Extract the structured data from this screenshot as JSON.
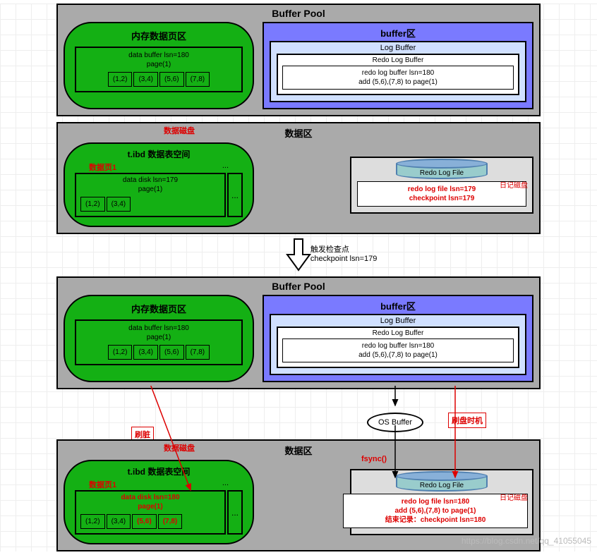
{
  "top": {
    "buffer_pool_title": "Buffer Pool",
    "mem_area_title": "内存数据页区",
    "data_buffer_text": "data buffer lsn=180\npage(1)",
    "cells": [
      "(1,2)",
      "(3,4)",
      "(5,6)",
      "(7,8)"
    ],
    "buffer_area_title": "buffer区",
    "log_buffer_title": "Log Buffer",
    "redo_log_buffer_title": "Redo Log Buffer",
    "redo_buffer_content": "redo log buffer lsn=180\nadd (5,6),(7,8) to page(1)",
    "data_area_title": "数据区",
    "data_disk_label": "数据磁盘",
    "tablespace_title": "t.ibd 数据表空间",
    "data_page_label": "数据页1",
    "data_disk_text": "data disk lsn=179\npage(1)",
    "disk_cells": [
      "(1,2)",
      "(3,4)"
    ],
    "dots": "...",
    "redo_log_file_title": "Redo Log File",
    "redo_disk_label": "日记磁盘",
    "redo_file_content": "redo log file lsn=179\ncheckpoint lsn=179"
  },
  "arrow": {
    "trigger_text": "触发检查点",
    "checkpoint_text": "checkpoint lsn=179"
  },
  "bottom": {
    "buffer_pool_title": "Buffer Pool",
    "mem_area_title": "内存数据页区",
    "data_buffer_text": "data buffer lsn=180\npage(1)",
    "cells": [
      "(1,2)",
      "(3,4)",
      "(5,6)",
      "(7,8)"
    ],
    "buffer_area_title": "buffer区",
    "log_buffer_title": "Log Buffer",
    "redo_log_buffer_title": "Redo Log Buffer",
    "redo_buffer_content": "redo log buffer lsn=180\nadd (5,6),(7,8) to page(1)",
    "os_buffer_label": "OS Buffer",
    "flush_timing_label": "刷盘时机",
    "fsync_label": "fsync()",
    "dirty_flush_label": "刷脏",
    "data_area_title": "数据区",
    "data_disk_label": "数据磁盘",
    "tablespace_title": "t.ibd 数据表空间",
    "data_page_label": "数据页1",
    "data_disk_text": "data disk lsn=180\npage(1)",
    "disk_cells": [
      "(1,2)",
      "(3,4)",
      "(5,6)",
      "(7,8)"
    ],
    "dots": "...",
    "redo_log_file_title": "Redo Log File",
    "redo_disk_label": "日记磁盘",
    "redo_file_content": "redo log file lsn=180\nadd (5,6),(7,8) to page(1)\n结束记录：checkpoint lsn=180"
  },
  "watermark": "https://blog.csdn.net/qq_41055045"
}
